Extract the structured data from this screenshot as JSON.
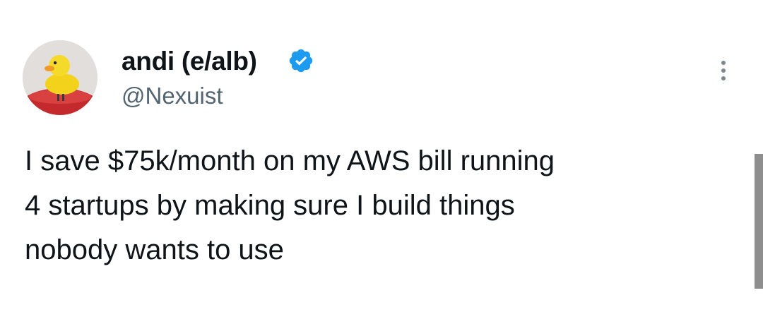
{
  "author": {
    "display_name": "andi (e/alb)",
    "handle": "@Nexuist",
    "verified": true,
    "avatar_icon": "rubber-duck-avatar",
    "verified_icon": "verified-badge-icon",
    "verified_color": "#1d9bf0"
  },
  "menu": {
    "icon": "more-options-icon"
  },
  "tweet": {
    "lines": [
      "I save $75k/month on my AWS bill running",
      "4 startups by making sure I build things",
      "nobody wants to use"
    ]
  },
  "colors": {
    "text": "#0f1419",
    "secondary_text": "#536471",
    "background": "#ffffff"
  }
}
